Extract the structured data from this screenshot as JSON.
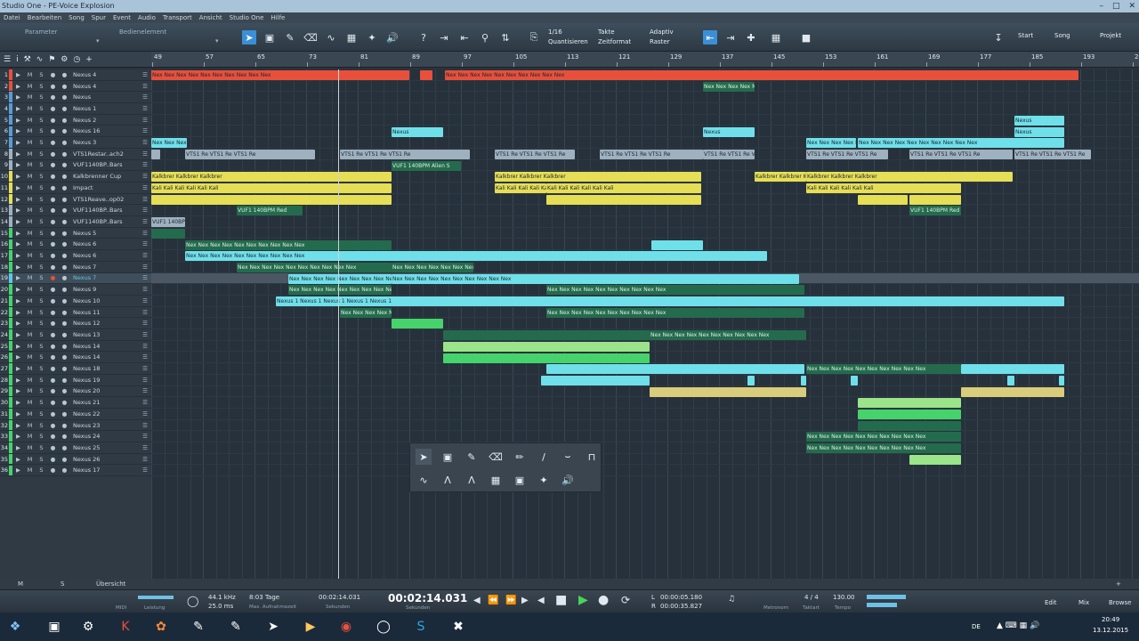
{
  "window": {
    "title": "Studio One - PE-Voice Explosion"
  },
  "menu": [
    "Datei",
    "Bearbeiten",
    "Song",
    "Spur",
    "Event",
    "Audio",
    "Transport",
    "Ansicht",
    "Studio One",
    "Hilfe"
  ],
  "toolbar": {
    "parameter_label": "Parameter",
    "bedienelement_label": "Bedienelement",
    "quantize_value": "1/16",
    "quantize_label": "Quantisieren",
    "timeformat_value": "Takte",
    "timeformat_label": "Zeitformat",
    "snap_value": "Adaptiv",
    "snap_label": "Raster",
    "nav_start": "Start",
    "nav_song": "Song",
    "nav_project": "Projekt"
  },
  "ruler": {
    "marks": [
      "49",
      "57",
      "65",
      "73",
      "81",
      "89",
      "97",
      "105",
      "113",
      "121",
      "129",
      "137",
      "145",
      "153",
      "161",
      "169",
      "177",
      "185",
      "193",
      "20"
    ]
  },
  "tracks": [
    {
      "num": "1",
      "name": "Nexus 4",
      "color": "#e8503c"
    },
    {
      "num": "2",
      "name": "Nexus 4",
      "color": "#e8503c"
    },
    {
      "num": "3",
      "name": "Nexus",
      "color": "#5a9bd6"
    },
    {
      "num": "4",
      "name": "Nexus 1",
      "color": "#5a9bd6"
    },
    {
      "num": "5",
      "name": "Nexus 2",
      "color": "#5a9bd6"
    },
    {
      "num": "6",
      "name": "Nexus 16",
      "color": "#5a9bd6"
    },
    {
      "num": "7",
      "name": "Nexus 3",
      "color": "#5a9bd6"
    },
    {
      "num": "8",
      "name": "VTS1Restar..ach2",
      "color": "#9fb1bf"
    },
    {
      "num": "9",
      "name": "VUF1140BP..Bars",
      "color": "#9fb1bf"
    },
    {
      "num": "10",
      "name": "Kalkbrenner Cup",
      "color": "#e6de55"
    },
    {
      "num": "11",
      "name": "Impact",
      "color": "#e6de55"
    },
    {
      "num": "12",
      "name": "VTS1Reave..op02",
      "color": "#e6de55"
    },
    {
      "num": "13",
      "name": "VUF1140BP..Bars",
      "color": "#9fb1bf"
    },
    {
      "num": "14",
      "name": "VUF1140BP..Bars",
      "color": "#9fb1bf"
    },
    {
      "num": "15",
      "name": "Nexus 5",
      "color": "#46d36b"
    },
    {
      "num": "16",
      "name": "Nexus 6",
      "color": "#46d36b"
    },
    {
      "num": "17",
      "name": "Nexus 6",
      "color": "#46d36b"
    },
    {
      "num": "18",
      "name": "Nexus 7",
      "color": "#46d36b"
    },
    {
      "num": "19",
      "name": "Nexus 7",
      "color": "#5fc7e6"
    },
    {
      "num": "20",
      "name": "Nexus 9",
      "color": "#46d36b"
    },
    {
      "num": "21",
      "name": "Nexus 10",
      "color": "#46d36b"
    },
    {
      "num": "22",
      "name": "Nexus 11",
      "color": "#46d36b"
    },
    {
      "num": "23",
      "name": "Nexus 12",
      "color": "#46d36b"
    },
    {
      "num": "24",
      "name": "Nexus 13",
      "color": "#46d36b"
    },
    {
      "num": "25",
      "name": "Nexus 14",
      "color": "#46d36b"
    },
    {
      "num": "26",
      "name": "Nexus 14",
      "color": "#46d36b"
    },
    {
      "num": "27",
      "name": "Nexus 18",
      "color": "#46d36b"
    },
    {
      "num": "28",
      "name": "Nexus 19",
      "color": "#46d36b"
    },
    {
      "num": "29",
      "name": "Nexus 20",
      "color": "#46d36b"
    },
    {
      "num": "30",
      "name": "Nexus 21",
      "color": "#46d36b"
    },
    {
      "num": "31",
      "name": "Nexus 22",
      "color": "#46d36b"
    },
    {
      "num": "32",
      "name": "Nexus 23",
      "color": "#46d36b"
    },
    {
      "num": "33",
      "name": "Nexus 24",
      "color": "#46d36b"
    },
    {
      "num": "34",
      "name": "Nexus 25",
      "color": "#46d36b"
    },
    {
      "num": "35",
      "name": "Nexus 26",
      "color": "#46d36b"
    },
    {
      "num": "36",
      "name": "Nexus 17",
      "color": "#46d36b"
    }
  ],
  "clip_labels": {
    "nex": "Nex Nex Nex Nex Nex Nex Nex Nex Nex Nex",
    "nexus": "Nexus",
    "nexus1": "Nexus 1 Nexus 1 Nexus 1 Nexus 1 Nexus 1",
    "vts": "VTS1 Re VTS1 Re VTS1 Re",
    "vuf": "VUF1 140BPM Alien S",
    "vuf_red": "VUF1 140BPM Red",
    "kalk": "Kalkbrer Kalkbrer Kalkbrer",
    "kali": "Kali Kali Kali Kali Kali Kali"
  },
  "bottom_bar": {
    "m": "M",
    "s": "S",
    "overview": "Übersicht"
  },
  "transport": {
    "midi": "MIDI",
    "performance": "Leistung",
    "samplerate": "44.1 kHz",
    "latency": "25.0 ms",
    "record_time": "8:03 Tage",
    "record_time_label": "Max. Aufnahmezeit",
    "seconds_small": "00:02:14.031",
    "seconds_label": "Sekunden",
    "time_big": "00:02:14.031",
    "time_big_label": "Sekunden",
    "loop_l": "00:00:05.180",
    "loop_r": "00:00:35.827",
    "loop_l_label": "L",
    "loop_r_label": "R",
    "metronome_label": "Metronom",
    "signature": "4 / 4",
    "signature_label": "Taktart",
    "tempo": "130.00",
    "tempo_label": "Tempo",
    "nav_edit": "Edit",
    "nav_mix": "Mix",
    "nav_browse": "Browse"
  },
  "taskbar": {
    "language": "DE",
    "time": "20:49",
    "date": "13.12.2015"
  }
}
